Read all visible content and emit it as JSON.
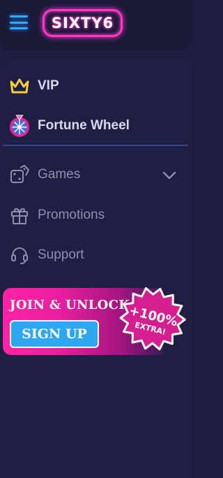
{
  "header": {
    "logo_text": "SIXTY6",
    "menu_icon": "hamburger-icon"
  },
  "menu": {
    "items": [
      {
        "label": "VIP",
        "icon": "crown-icon"
      },
      {
        "label": "Fortune Wheel",
        "icon": "fortune-wheel-icon"
      },
      {
        "label": "Games",
        "icon": "dice-icon",
        "has_submenu": true
      },
      {
        "label": "Promotions",
        "icon": "gift-icon"
      },
      {
        "label": "Support",
        "icon": "headset-icon"
      }
    ]
  },
  "promo": {
    "title": "JOIN & UNLOCK",
    "button_label": "SIGN UP",
    "badge_line1": "+100%",
    "badge_line2": "EXTRA!"
  },
  "colors": {
    "background": "#1d1d40",
    "accent_pink": "#ff37c6",
    "accent_blue": "#34a8ff",
    "crown_yellow": "#f4d03f"
  }
}
